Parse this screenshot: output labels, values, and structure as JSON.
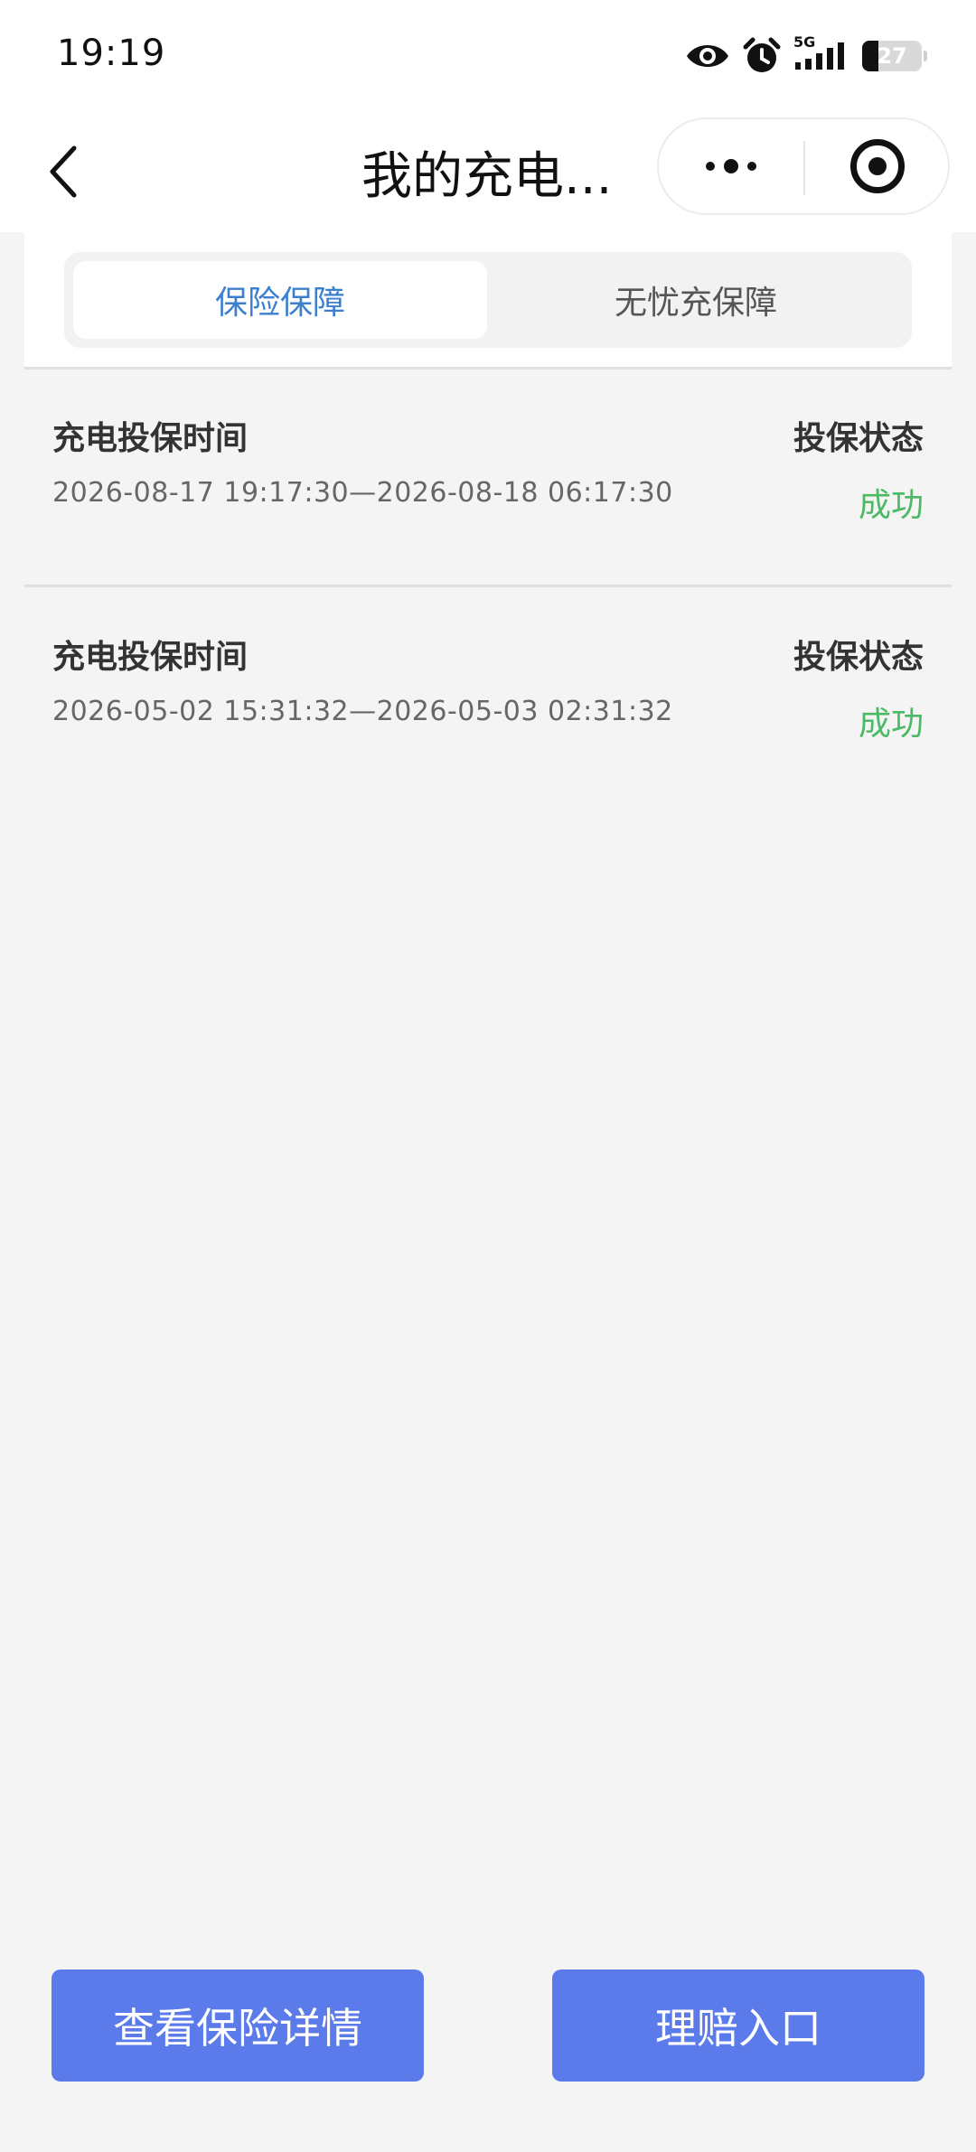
{
  "status_bar": {
    "time": "19:19",
    "network": "5G",
    "battery": "27",
    "icons": [
      "eye-icon",
      "alarm-icon",
      "signal-icon",
      "battery-icon"
    ]
  },
  "nav": {
    "title": "我的充电...",
    "back_icon": "chevron-left-icon",
    "more_icon": "more-dots-icon",
    "close_icon": "target-close-icon"
  },
  "tabs": [
    {
      "label": "保险保障",
      "active": true
    },
    {
      "label": "无忧充保障",
      "active": false
    }
  ],
  "records": [
    {
      "label": "充电投保时间",
      "time_range": "2026-08-17 19:17:30—2026-08-18 06:17:30",
      "status_label": "投保状态",
      "status": "成功"
    },
    {
      "label": "充电投保时间",
      "time_range": "2026-05-02 15:31:32—2026-05-03 02:31:32",
      "status_label": "投保状态",
      "status": "成功"
    }
  ],
  "buttons": {
    "view_details": "查看保险详情",
    "claim_entry": "理赔入口"
  },
  "colors": {
    "accent": "#3a7fd0",
    "button": "#5b7bea",
    "success": "#4cb964",
    "background": "#f4f4f4"
  }
}
